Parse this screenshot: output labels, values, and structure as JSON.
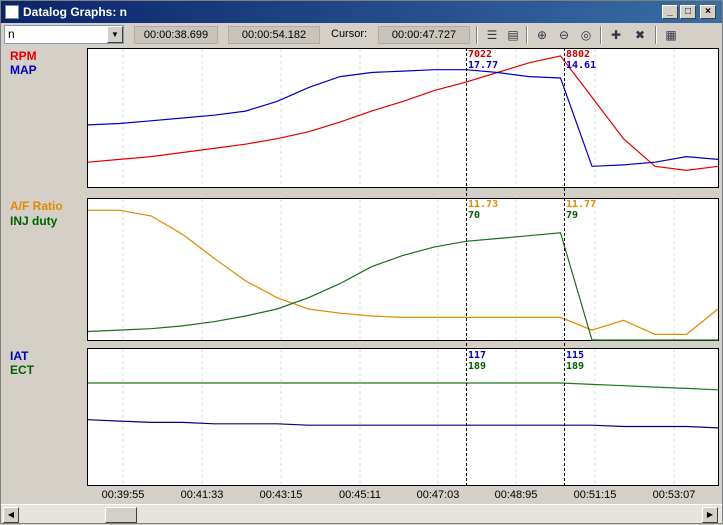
{
  "window": {
    "title": "Datalog Graphs: n"
  },
  "toolbar": {
    "log_select": "n",
    "start_time": "00:00:38.699",
    "end_time": "00:00:54.182",
    "cursor_label": "Cursor:",
    "cursor_time": "00:00:47.727",
    "icons": [
      "list-icon",
      "table-icon",
      "zoom-in-icon",
      "zoom-out-icon",
      "zoom-fit-icon",
      "add-channel-icon",
      "remove-channel-icon",
      "colors-icon"
    ]
  },
  "graphs": [
    {
      "id": "top",
      "labels": [
        {
          "text": "RPM",
          "color": "#e00000"
        },
        {
          "text": "MAP",
          "color": "#0000c0"
        }
      ],
      "cursor1": [
        "7022",
        "17.77"
      ],
      "cursor2": [
        "8802",
        "14.61"
      ]
    },
    {
      "id": "mid",
      "labels": [
        {
          "text": "A/F Ratio",
          "color": "#e08a00"
        },
        {
          "text": "INJ duty",
          "color": "#006000"
        }
      ],
      "cursor1": [
        "11.73",
        "70"
      ],
      "cursor2": [
        "11.77",
        "79"
      ]
    },
    {
      "id": "bot",
      "labels": [
        {
          "text": "IAT",
          "color": "#0000c0"
        },
        {
          "text": "ECT",
          "color": "#006000"
        }
      ],
      "cursor1": [
        "117",
        "189"
      ],
      "cursor2": [
        "115",
        "189"
      ]
    }
  ],
  "x_axis": {
    "labels": [
      "00:39:55",
      "00:41:33",
      "00:43:15",
      "00:45:11",
      "00:47:03",
      "00:48:95",
      "00:51:15",
      "00:53:07"
    ]
  },
  "colors": {
    "rpm": "#e00000",
    "map": "#0000c0",
    "afr": "#e08a00",
    "inj": "#1a6e1a",
    "iat": "#00008b",
    "ect": "#1a7a1a"
  },
  "chart_data": {
    "type": "line",
    "panels": [
      {
        "series": [
          {
            "name": "RPM",
            "values": [
              0.18,
              0.2,
              0.22,
              0.25,
              0.28,
              0.31,
              0.35,
              0.4,
              0.47,
              0.55,
              0.62,
              0.7,
              0.76,
              0.83,
              0.9,
              0.95,
              0.65,
              0.35,
              0.15,
              0.12,
              0.15
            ]
          },
          {
            "name": "MAP",
            "values": [
              0.45,
              0.46,
              0.48,
              0.5,
              0.52,
              0.55,
              0.62,
              0.72,
              0.8,
              0.83,
              0.84,
              0.85,
              0.85,
              0.83,
              0.8,
              0.79,
              0.15,
              0.16,
              0.18,
              0.22,
              0.2
            ]
          }
        ]
      },
      {
        "series": [
          {
            "name": "A/F Ratio",
            "values": [
              0.92,
              0.92,
              0.88,
              0.75,
              0.58,
              0.42,
              0.3,
              0.22,
              0.19,
              0.17,
              0.16,
              0.16,
              0.16,
              0.16,
              0.16,
              0.16,
              0.07,
              0.14,
              0.04,
              0.04,
              0.22
            ]
          },
          {
            "name": "INJ duty",
            "values": [
              0.06,
              0.07,
              0.08,
              0.1,
              0.13,
              0.17,
              0.22,
              0.3,
              0.4,
              0.52,
              0.6,
              0.66,
              0.7,
              0.72,
              0.74,
              0.76,
              0.0,
              0.0,
              0.0,
              0.0,
              0.0
            ]
          }
        ]
      },
      {
        "series": [
          {
            "name": "IAT",
            "values": [
              0.48,
              0.47,
              0.46,
              0.46,
              0.45,
              0.45,
              0.45,
              0.44,
              0.44,
              0.44,
              0.44,
              0.44,
              0.44,
              0.44,
              0.44,
              0.44,
              0.44,
              0.43,
              0.43,
              0.43,
              0.42
            ]
          },
          {
            "name": "ECT",
            "values": [
              0.75,
              0.75,
              0.75,
              0.75,
              0.75,
              0.75,
              0.75,
              0.75,
              0.75,
              0.75,
              0.75,
              0.75,
              0.75,
              0.75,
              0.75,
              0.75,
              0.74,
              0.73,
              0.72,
              0.71,
              0.7
            ]
          }
        ]
      }
    ]
  }
}
